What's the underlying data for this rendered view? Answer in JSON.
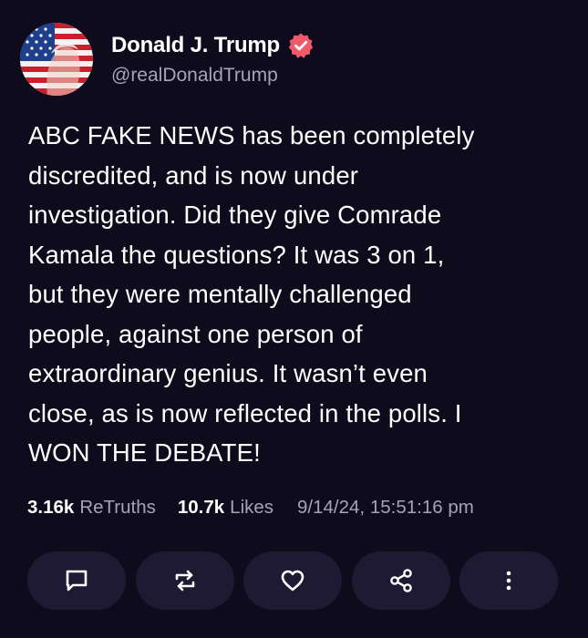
{
  "post": {
    "author": {
      "display_name": "Donald J. Trump",
      "handle": "@realDonaldTrump",
      "verified": true,
      "avatar_icon": "flag-portrait-avatar"
    },
    "text": "ABC FAKE NEWS has been completely\ndiscredited, and is now under\ninvestigation. Did they give Comrade\nKamala the questions? It was 3 on 1,\nbut they were mentally challenged\npeople, against one person of\nextraordinary genius. It wasn’t even\nclose, as is now reflected in the polls. I\nWON THE DEBATE!",
    "stats": {
      "retruths_count": "3.16k",
      "retruths_label": "ReTruths",
      "likes_count": "10.7k",
      "likes_label": "Likes",
      "timestamp": "9/14/24, 15:51:16 pm"
    },
    "actions": [
      {
        "name": "reply",
        "icon": "comment-icon"
      },
      {
        "name": "retruth",
        "icon": "repost-icon"
      },
      {
        "name": "like",
        "icon": "heart-icon"
      },
      {
        "name": "share",
        "icon": "share-icon"
      },
      {
        "name": "more",
        "icon": "more-vertical-icon"
      }
    ]
  },
  "colors": {
    "background": "#0e0b1c",
    "button_background": "#1e1a33",
    "muted_text": "#a7a3b7",
    "verified_badge": "#ef5a6a"
  }
}
